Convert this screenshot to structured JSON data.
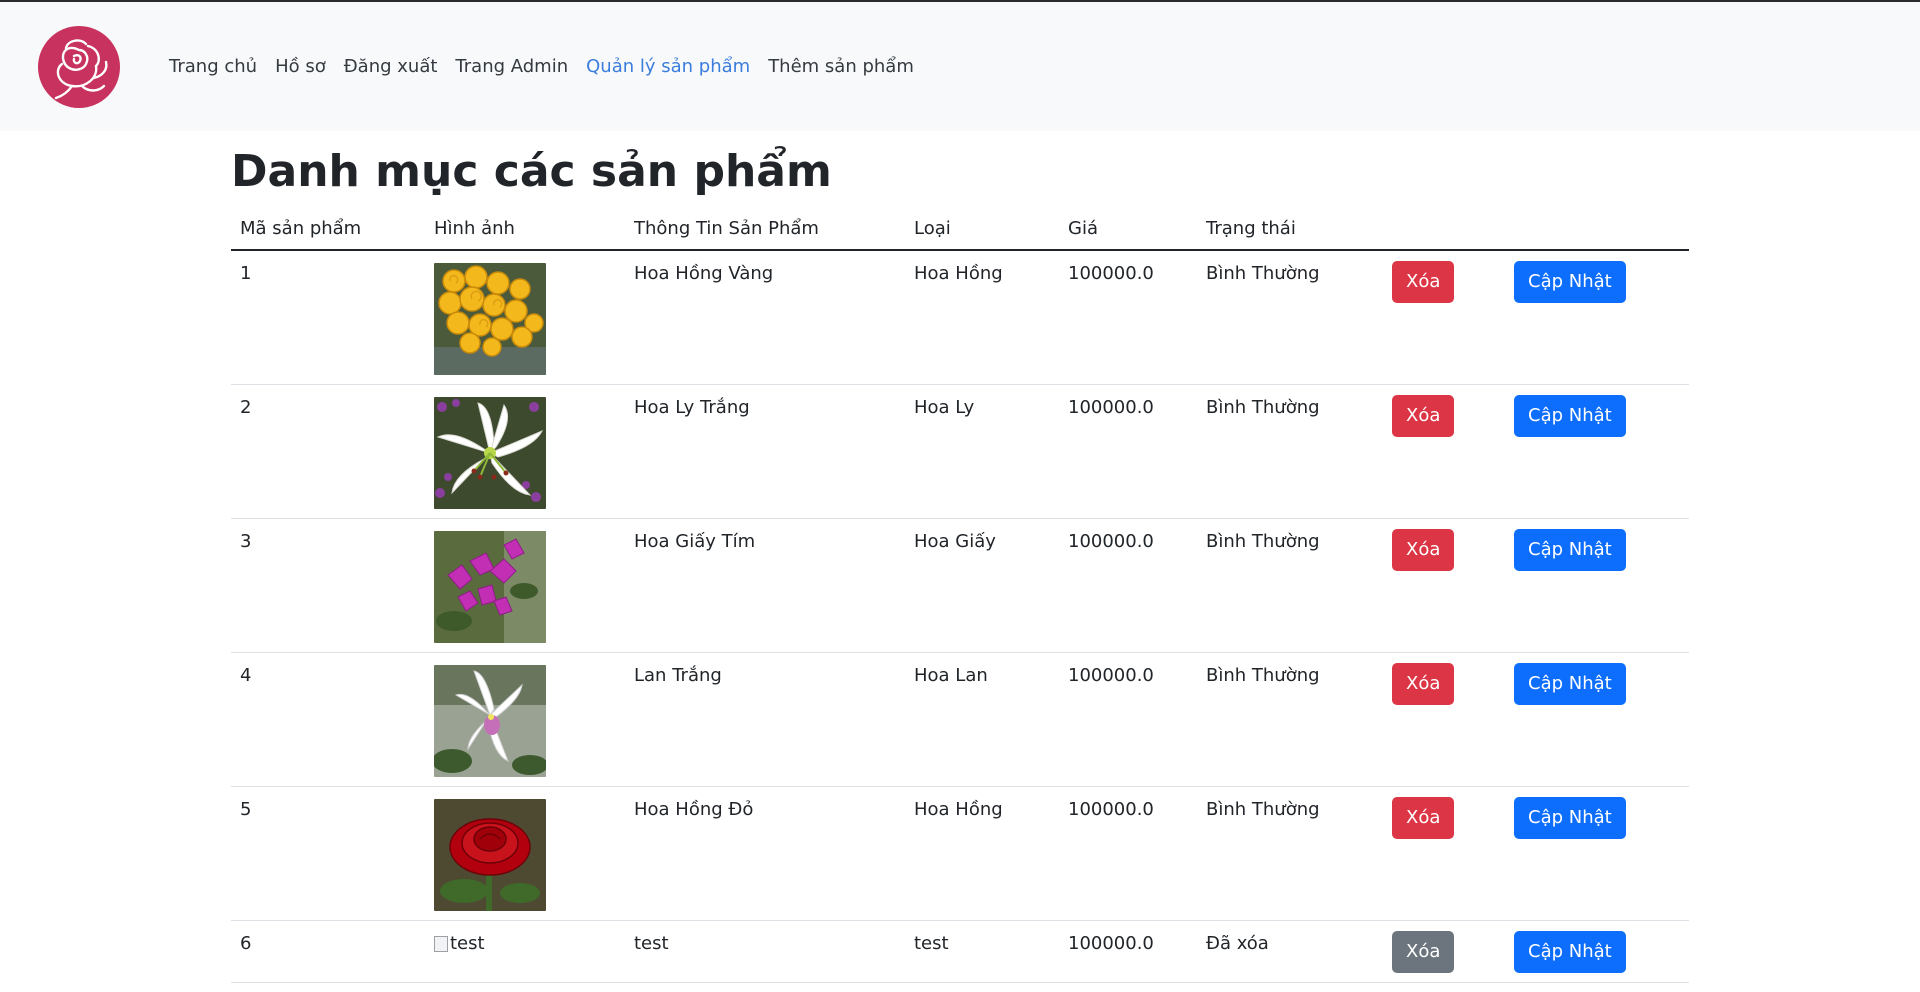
{
  "nav": {
    "links": [
      "Trang chủ",
      "Hồ sơ",
      "Đăng xuất",
      "Trang Admin",
      "Quản lý sản phẩm",
      "Thêm sản phẩm"
    ],
    "active_index": 4
  },
  "page_title": "Danh mục các sản phẩm",
  "table": {
    "headers": [
      "Mã sản phẩm",
      "Hình ảnh",
      "Thông Tin Sản Phẩm",
      "Loại",
      "Giá",
      "Trạng thái"
    ],
    "rows": [
      {
        "id": "1",
        "image": "yellow-roses",
        "name": "Hoa Hồng Vàng",
        "type": "Hoa Hồng",
        "price": "100000.0",
        "status": "Bình Thường",
        "delete": "Xóa",
        "update": "Cập Nhật"
      },
      {
        "id": "2",
        "image": "white-lily",
        "name": "Hoa Ly Trắng",
        "type": "Hoa Ly",
        "price": "100000.0",
        "status": "Bình Thường",
        "delete": "Xóa",
        "update": "Cập Nhật"
      },
      {
        "id": "3",
        "image": "purple-bougainvillea",
        "name": "Hoa Giấy Tím",
        "type": "Hoa Giấy",
        "price": "100000.0",
        "status": "Bình Thường",
        "delete": "Xóa",
        "update": "Cập Nhật"
      },
      {
        "id": "4",
        "image": "white-orchid",
        "name": "Lan Trắng",
        "type": "Hoa Lan",
        "price": "100000.0",
        "status": "Bình Thường",
        "delete": "Xóa",
        "update": "Cập Nhật"
      },
      {
        "id": "5",
        "image": "red-rose",
        "name": "Hoa Hồng Đỏ",
        "type": "Hoa Hồng",
        "price": "100000.0",
        "status": "Bình Thường",
        "delete": "Xóa",
        "update": "Cập Nhật"
      },
      {
        "id": "6",
        "image_alt": "test",
        "name": "test",
        "type": "test",
        "price": "100000.0",
        "status": "Đã xóa",
        "delete": "Xóa",
        "update": "Cập Nhật"
      }
    ]
  },
  "colors": {
    "danger": "#dc3545",
    "secondary": "#6c757d",
    "primary": "#0d6efd",
    "nav_active": "#3b7ddd",
    "logo": "#c8325e"
  }
}
